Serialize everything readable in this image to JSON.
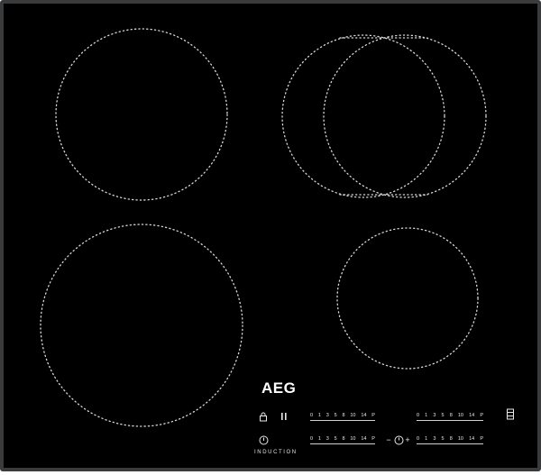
{
  "brand": "AEG",
  "type_label": "INDUCTION",
  "colors": {
    "glass": "#000000",
    "frame": "#3a3b3d",
    "marking": "#d8d8d8"
  },
  "cooking_zones": [
    "zone-front-left",
    "zone-rear-left",
    "zone-rear-right-bridge",
    "zone-front-right"
  ],
  "controls": {
    "slider_ticks": [
      "0",
      "1",
      "3",
      "5",
      "8",
      "10",
      "14",
      "P"
    ],
    "sliders": [
      "slider-rear-left",
      "slider-rear-right",
      "slider-front-left",
      "slider-front-right"
    ],
    "lock_icon": "lock-icon",
    "pause_icon": "pause-icon",
    "power_icon": "power-icon",
    "timer_icon": "timer-icon",
    "bridge_icon": "bridge-icon",
    "timer_minus": "−",
    "timer_plus": "+"
  }
}
